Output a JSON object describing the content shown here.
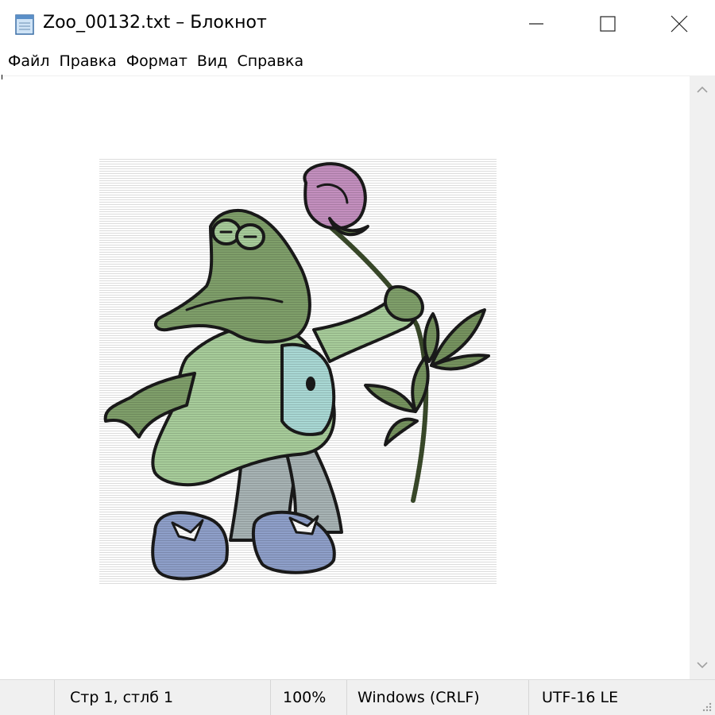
{
  "window": {
    "title": "Zoo_00132.txt – Блокнот",
    "icon": "notepad-icon"
  },
  "controls": {
    "minimize_icon": "minimize-icon",
    "maximize_icon": "maximize-icon",
    "close_icon": "close-icon"
  },
  "menu": {
    "items": [
      {
        "label": "Файл"
      },
      {
        "label": "Правка"
      },
      {
        "label": "Формат"
      },
      {
        "label": "Вид"
      },
      {
        "label": "Справка"
      }
    ]
  },
  "editor": {
    "content_description_icon": "crocodile-with-rose-ascii-art"
  },
  "status": {
    "position": "Стр 1, стлб 1",
    "zoom": "100%",
    "line_endings": "Windows (CRLF)",
    "encoding": "UTF-16 LE"
  },
  "colors": {
    "crocodile_green": "#7f9f6a",
    "jacket_green": "#a7cc9a",
    "vest_teal": "#a9d8d4",
    "pants_gray": "#a7b3b4",
    "shoes_blue": "#8e9fc9",
    "rose_pink": "#c38fbe",
    "leaf_green": "#76935f"
  }
}
